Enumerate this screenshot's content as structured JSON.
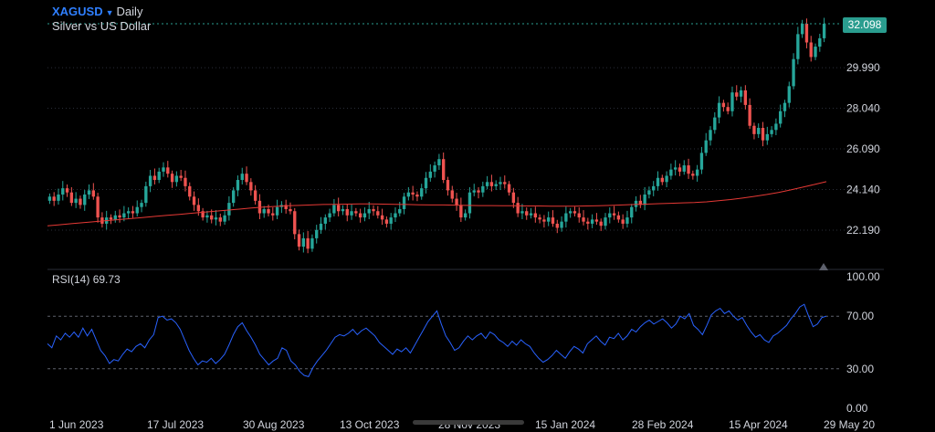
{
  "header": {
    "symbol": "XAGUSD",
    "timeframe": "Daily",
    "description": "Silver vs US Dollar"
  },
  "colors": {
    "up": "#26a69a",
    "down": "#ef5350",
    "ma": "#e53935",
    "rsi": "#2962ff",
    "last": "#2a9d8f",
    "grid": "#2a2e39",
    "text": "#d1d4dc",
    "bg": "#000000"
  },
  "price_axis": {
    "labels": [
      "32.098",
      "29.990",
      "28.040",
      "26.090",
      "24.140",
      "22.190"
    ],
    "last_label": "32.098"
  },
  "rsi": {
    "label": "RSI(14)",
    "value": "69.73",
    "axis_labels": [
      "100.00",
      "70.00",
      "30.00",
      "0.00"
    ]
  },
  "time_axis": {
    "labels": [
      "1 Jun 2023",
      "17 Jul 2023",
      "30 Aug 2023",
      "13 Oct 2023",
      "28 Nov 2023",
      "15 Jan 2024",
      "28 Feb 2024",
      "15 Apr 2024",
      "29 May 20"
    ]
  },
  "chart_data": [
    {
      "type": "line",
      "title": "XAGUSD Daily",
      "price_range": [
        21.0,
        33.3
      ],
      "series": [
        {
          "name": "XAGUSD",
          "kind": "candlestick",
          "closes": [
            23.8,
            23.6,
            23.9,
            24.2,
            24.0,
            23.5,
            23.7,
            23.4,
            23.9,
            24.1,
            23.8,
            22.8,
            22.5,
            22.8,
            22.7,
            22.9,
            22.8,
            23.0,
            23.1,
            23.0,
            23.3,
            23.5,
            24.3,
            24.8,
            24.6,
            25.0,
            25.2,
            24.9,
            24.5,
            24.8,
            24.7,
            24.3,
            23.8,
            23.4,
            23.1,
            22.8,
            22.9,
            22.7,
            22.8,
            22.6,
            22.9,
            23.5,
            24.1,
            24.6,
            24.9,
            24.5,
            24.1,
            23.6,
            23.0,
            23.2,
            23.0,
            22.9,
            23.3,
            23.4,
            23.2,
            23.1,
            22.0,
            21.4,
            21.8,
            21.3,
            21.8,
            22.2,
            22.5,
            22.8,
            23.0,
            23.4,
            23.1,
            23.2,
            22.9,
            23.1,
            23.0,
            22.8,
            23.0,
            23.2,
            23.1,
            22.9,
            22.7,
            22.5,
            22.8,
            23.0,
            23.2,
            23.8,
            24.0,
            23.9,
            23.8,
            24.2,
            24.7,
            25.0,
            25.3,
            25.6,
            24.6,
            24.1,
            23.7,
            23.4,
            22.8,
            23.0,
            24.0,
            24.1,
            24.0,
            24.3,
            24.5,
            24.3,
            24.4,
            24.5,
            24.4,
            24.0,
            23.5,
            23.0,
            23.1,
            22.9,
            23.0,
            22.8,
            22.7,
            22.6,
            22.8,
            22.5,
            22.3,
            22.6,
            23.0,
            23.1,
            23.0,
            22.8,
            22.6,
            22.5,
            22.7,
            22.6,
            22.4,
            22.8,
            23.0,
            22.9,
            22.7,
            22.5,
            22.8,
            23.3,
            23.6,
            23.4,
            23.9,
            24.1,
            24.3,
            24.7,
            24.5,
            24.8,
            25.1,
            25.2,
            25.0,
            25.3,
            24.9,
            24.8,
            25.1,
            25.9,
            26.5,
            27.0,
            27.6,
            28.3,
            28.1,
            27.9,
            28.8,
            28.6,
            28.9,
            28.2,
            27.2,
            26.8,
            27.1,
            26.5,
            26.8,
            27.0,
            27.3,
            27.9,
            28.3,
            29.1,
            30.4,
            31.6,
            32.1,
            31.2,
            30.5,
            31.0,
            31.4,
            32.1
          ]
        },
        {
          "name": "MA",
          "kind": "line",
          "values": [
            22.4,
            22.45,
            22.5,
            22.55,
            22.6,
            22.65,
            22.7,
            22.75,
            22.8,
            22.85,
            22.9,
            22.95,
            23.0,
            23.05,
            23.1,
            23.15,
            23.2,
            23.25,
            23.3,
            23.33,
            23.36,
            23.38,
            23.4,
            23.42,
            23.43,
            23.44,
            23.45,
            23.45,
            23.44,
            23.43,
            23.42,
            23.41,
            23.4,
            23.4,
            23.39,
            23.38,
            23.37,
            23.37,
            23.36,
            23.36,
            23.35,
            23.35,
            23.34,
            23.34,
            23.34,
            23.35,
            23.36,
            23.38,
            23.4,
            23.42,
            23.44,
            23.46,
            23.48,
            23.5,
            23.52,
            23.55,
            23.6,
            23.66,
            23.73,
            23.81,
            23.9,
            24.0,
            24.12,
            24.25,
            24.38,
            24.52
          ]
        }
      ]
    },
    {
      "type": "line",
      "title": "RSI(14)",
      "ylim": [
        0,
        100
      ],
      "series": [
        {
          "name": "RSI(14)",
          "values": [
            49,
            46,
            55,
            52,
            57,
            54,
            58,
            54,
            61,
            55,
            60,
            52,
            44,
            40,
            34,
            37,
            36,
            41,
            45,
            43,
            47,
            49,
            46,
            52,
            56,
            69,
            70,
            67,
            68,
            65,
            60,
            52,
            44,
            38,
            33,
            36,
            35,
            38,
            34,
            37,
            41,
            48,
            56,
            62,
            65,
            59,
            54,
            48,
            41,
            37,
            33,
            36,
            38,
            46,
            44,
            36,
            33,
            28,
            25,
            24,
            31,
            36,
            40,
            44,
            49,
            54,
            56,
            55,
            57,
            60,
            56,
            59,
            61,
            58,
            55,
            50,
            47,
            44,
            41,
            45,
            43,
            46,
            42,
            48,
            54,
            60,
            66,
            70,
            74,
            64,
            55,
            50,
            44,
            46,
            51,
            55,
            52,
            55,
            57,
            53,
            58,
            56,
            52,
            50,
            47,
            51,
            48,
            52,
            49,
            47,
            42,
            38,
            35,
            37,
            40,
            44,
            41,
            38,
            43,
            47,
            45,
            42,
            49,
            52,
            55,
            51,
            48,
            54,
            53,
            57,
            52,
            55,
            60,
            58,
            62,
            65,
            67,
            64,
            66,
            68,
            65,
            61,
            64,
            70,
            68,
            72,
            63,
            60,
            56,
            63,
            71,
            74,
            76,
            72,
            74,
            70,
            67,
            69,
            63,
            58,
            54,
            56,
            52,
            50,
            55,
            57,
            60,
            63,
            68,
            72,
            77,
            79,
            70,
            62,
            64,
            69,
            70
          ]
        }
      ]
    }
  ]
}
